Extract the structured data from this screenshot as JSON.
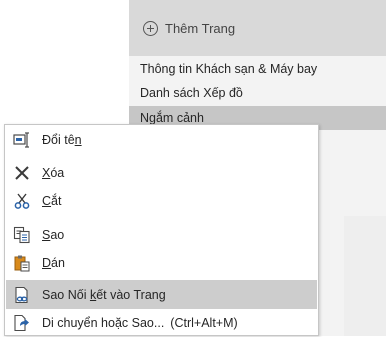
{
  "page_list": {
    "add_page_label": "Thêm Trang",
    "pages": [
      {
        "label": "Thông tin Khách sạn & Máy bay"
      },
      {
        "label": "Danh sách Xếp đồ"
      },
      {
        "label": "Ngắm cảnh"
      }
    ]
  },
  "context_menu": {
    "items": [
      {
        "icon": "rename-icon",
        "before": "Đổi tê",
        "key": "n",
        "after": ""
      },
      {
        "icon": "delete-x-icon",
        "before": "",
        "key": "X",
        "after": "óa"
      },
      {
        "icon": "scissors-icon",
        "before": "",
        "key": "C",
        "after": "ắt"
      },
      {
        "icon": "copy-icon",
        "before": "",
        "key": "S",
        "after": "ao"
      },
      {
        "icon": "paste-clipboard-icon",
        "before": "",
        "key": "D",
        "after": "án"
      },
      {
        "icon": "link-page-icon",
        "before": "Sao Nối ",
        "key": "k",
        "after": "ết vào Trang"
      },
      {
        "icon": "move-copy-icon",
        "before": "Di chuyển hoặc Sao...",
        "key": "",
        "after": "",
        "shortcut": "(Ctrl+Alt+M)"
      }
    ]
  },
  "colors": {
    "menu_highlight": "#cdcdcd",
    "selected_page": "#c6c6c6",
    "icon_blue": "#2b63a8",
    "icon_orange": "#d88a1b"
  }
}
